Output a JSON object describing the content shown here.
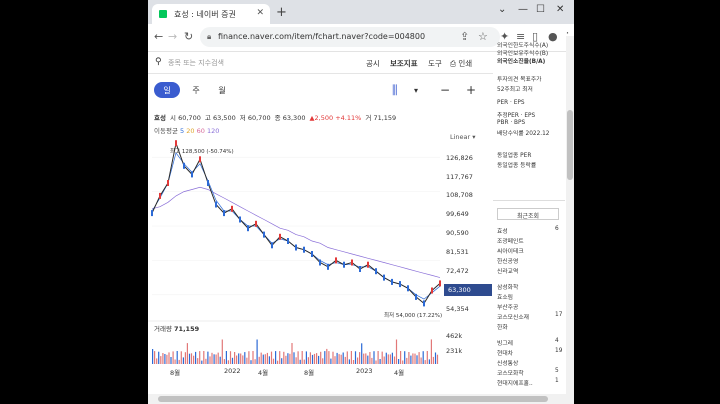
{
  "browser": {
    "tab_title": "효성 : 네이버 증권",
    "url": "finance.naver.com/item/fchart.naver?code=004800"
  },
  "toolbar": {
    "search_placeholder": "종목 또는 지수검색",
    "links": [
      "공시",
      "보조지표",
      "도구",
      "인쇄"
    ]
  },
  "periods": [
    "일",
    "주",
    "월"
  ],
  "active_period": "일",
  "price": {
    "name": "효성",
    "open": "시 60,700",
    "high": "고 63,500",
    "low": "저 60,700",
    "close": "종 63,300",
    "change": "▲2,500 +4.11%",
    "volume": "거 71,159"
  },
  "ma": {
    "label": "이동평균",
    "values": [
      "5",
      "20",
      "60",
      "120"
    ],
    "colors": [
      "#2c6ad6",
      "#e0a52c",
      "#d86a9a",
      "#8a6fd8"
    ]
  },
  "scale_mode": "Linear",
  "annotations": {
    "high": "최고 128,500 (-50.74%)",
    "low": "최저 54,000 (17.22%)"
  },
  "y_ticks": [
    "126,826",
    "117,767",
    "108,708",
    "99,649",
    "90,590",
    "81,531",
    "72,472",
    "63,300",
    "54,354"
  ],
  "current_price_tag": "63,300",
  "volume": {
    "label": "거래량",
    "value": "71,159",
    "ticks": [
      "462k",
      "231k"
    ]
  },
  "x_labels": [
    "8월",
    "2022",
    "4월",
    "8월",
    "2023",
    "4월"
  ],
  "sidebar": {
    "top_items": [
      "외국인한도주식수(A)",
      "외국인보유주식수(B)",
      "외국인소진율(B/A)",
      "투자의견 목표주가",
      "52주최고 최저",
      "PER · EPS",
      "추정PER · EPS",
      "PBR · BPS",
      "배당수익률 2022.12",
      "동일업종 PER",
      "동일업종 등락률"
    ],
    "recent_tab": "최근조회",
    "recent": [
      {
        "name": "효성",
        "value": "6"
      },
      {
        "name": "조광페인트",
        "value": ""
      },
      {
        "name": "씨아이테크",
        "value": ""
      },
      {
        "name": "한신공영",
        "value": ""
      },
      {
        "name": "신라교역",
        "value": ""
      },
      {
        "name": "삼성화학",
        "value": ""
      },
      {
        "name": "효소림",
        "value": ""
      },
      {
        "name": "부산주공",
        "value": ""
      },
      {
        "name": "코스모신소재",
        "value": "17"
      },
      {
        "name": "한화",
        "value": ""
      },
      {
        "name": "빙그레",
        "value": "4"
      },
      {
        "name": "현대차",
        "value": "19"
      },
      {
        "name": "신성통상",
        "value": ""
      },
      {
        "name": "코스모화학",
        "value": "5"
      },
      {
        "name": "현대지에프홀..",
        "value": "1"
      }
    ]
  },
  "chart_data": {
    "type": "line",
    "title": "",
    "ylim": [
      50000,
      130000
    ],
    "series": [
      {
        "name": "종가",
        "color": "#2a2a2a",
        "values": [
          96000,
          104000,
          110000,
          128500,
          118000,
          114000,
          121000,
          110000,
          100000,
          96000,
          98000,
          93000,
          89000,
          91000,
          86000,
          81000,
          85000,
          83000,
          80000,
          79000,
          77000,
          73000,
          71000,
          74000,
          72000,
          73000,
          70000,
          72000,
          69000,
          66000,
          64000,
          63000,
          61000,
          57000,
          54000,
          60000,
          63300
        ]
      },
      {
        "name": "5",
        "color": "#2c6ad6",
        "values": [
          97000,
          103000,
          110000,
          124000,
          119000,
          115000,
          119000,
          111000,
          102000,
          97000,
          97000,
          93000,
          90000,
          90000,
          86000,
          82000,
          84000,
          83000,
          80000,
          79000,
          77000,
          74000,
          72000,
          73000,
          72000,
          72000,
          71000,
          71000,
          69000,
          66000,
          64000,
          63000,
          61000,
          58000,
          56000,
          59000,
          62000
        ]
      },
      {
        "name": "120",
        "color": "#8a6fd8",
        "values": [
          98000,
          99000,
          101000,
          104000,
          106000,
          107000,
          108000,
          107000,
          105000,
          103000,
          101000,
          99000,
          97000,
          95000,
          93000,
          91000,
          89000,
          88000,
          86000,
          85000,
          83000,
          82000,
          80000,
          79000,
          78000,
          77000,
          76000,
          75000,
          74000,
          73000,
          72000,
          71000,
          70000,
          69000,
          68000,
          67000,
          66000
        ]
      }
    ]
  }
}
